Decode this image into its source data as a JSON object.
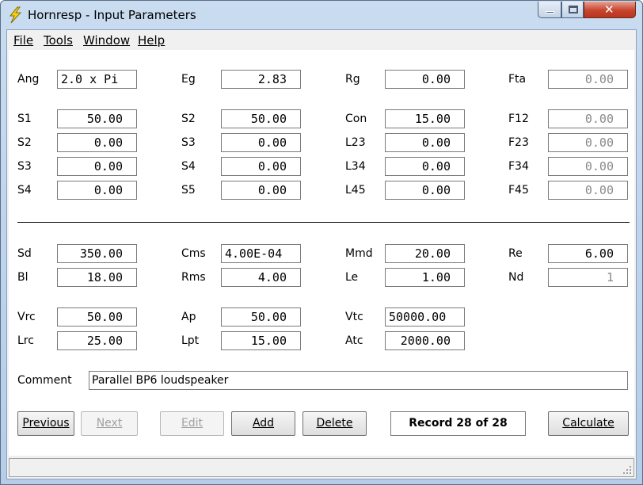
{
  "window": {
    "title": "Hornresp - Input Parameters",
    "controls": {
      "minimize": "minimize-icon",
      "maximize": "maximize-icon",
      "close": "close-icon"
    }
  },
  "menu": {
    "file": "File",
    "tools": "Tools",
    "window": "Window",
    "help": "Help"
  },
  "fields": {
    "ang": {
      "label": "Ang",
      "value": "2.0 x Pi"
    },
    "eg": {
      "label": "Eg",
      "value": "2.83"
    },
    "rg": {
      "label": "Rg",
      "value": "0.00"
    },
    "fta": {
      "label": "Fta",
      "value": "0.00"
    },
    "s1a": {
      "label": "S1",
      "value": "50.00"
    },
    "s2a": {
      "label": "S2",
      "value": "50.00"
    },
    "con": {
      "label": "Con",
      "value": "15.00"
    },
    "f12": {
      "label": "F12",
      "value": "0.00"
    },
    "s2b": {
      "label": "S2",
      "value": "0.00"
    },
    "s3a": {
      "label": "S3",
      "value": "0.00"
    },
    "l23": {
      "label": "L23",
      "value": "0.00"
    },
    "f23": {
      "label": "F23",
      "value": "0.00"
    },
    "s3b": {
      "label": "S3",
      "value": "0.00"
    },
    "s4a": {
      "label": "S4",
      "value": "0.00"
    },
    "l34": {
      "label": "L34",
      "value": "0.00"
    },
    "f34": {
      "label": "F34",
      "value": "0.00"
    },
    "s4b": {
      "label": "S4",
      "value": "0.00"
    },
    "s5": {
      "label": "S5",
      "value": "0.00"
    },
    "l45": {
      "label": "L45",
      "value": "0.00"
    },
    "f45": {
      "label": "F45",
      "value": "0.00"
    },
    "sd": {
      "label": "Sd",
      "value": "350.00"
    },
    "cms": {
      "label": "Cms",
      "value": "4.00E-04"
    },
    "mmd": {
      "label": "Mmd",
      "value": "20.00"
    },
    "re": {
      "label": "Re",
      "value": "6.00"
    },
    "bl": {
      "label": "Bl",
      "value": "18.00"
    },
    "rms": {
      "label": "Rms",
      "value": "4.00"
    },
    "le": {
      "label": "Le",
      "value": "1.00"
    },
    "nd": {
      "label": "Nd",
      "value": "1"
    },
    "vrc": {
      "label": "Vrc",
      "value": "50.00"
    },
    "ap": {
      "label": "Ap",
      "value": "50.00"
    },
    "vtc": {
      "label": "Vtc",
      "value": "50000.00"
    },
    "lrc": {
      "label": "Lrc",
      "value": "25.00"
    },
    "lpt": {
      "label": "Lpt",
      "value": "15.00"
    },
    "atc": {
      "label": "Atc",
      "value": "2000.00"
    },
    "comment": {
      "label": "Comment",
      "value": "Parallel BP6 loudspeaker"
    }
  },
  "buttons": {
    "previous": "Previous",
    "next": "Next",
    "edit": "Edit",
    "add": "Add",
    "delete": "Delete",
    "calculate": "Calculate"
  },
  "record": "Record 28 of 28",
  "status": ""
}
